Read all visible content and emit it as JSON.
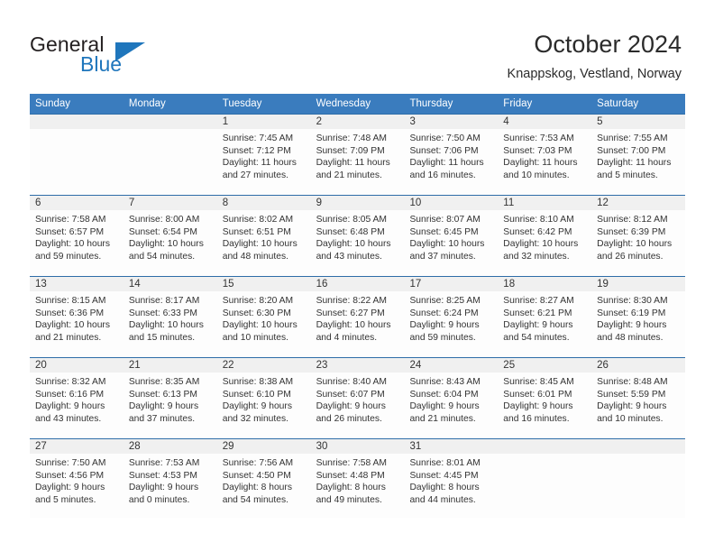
{
  "brand": {
    "name_part1": "General",
    "name_part2": "Blue",
    "logo_icon": "blue-triangle-logo"
  },
  "header": {
    "title": "October 2024",
    "location": "Knappskog, Vestland, Norway"
  },
  "colors": {
    "header_blue": "#3a7cbe",
    "row_divider_blue": "#2e6da8",
    "date_band_gray": "#f0f0f0",
    "brand_blue": "#1f76bc",
    "text": "#333333"
  },
  "calendar": {
    "weekday_headers": [
      "Sunday",
      "Monday",
      "Tuesday",
      "Wednesday",
      "Thursday",
      "Friday",
      "Saturday"
    ],
    "weeks": [
      [
        {
          "day": "",
          "lines": []
        },
        {
          "day": "",
          "lines": []
        },
        {
          "day": "1",
          "lines": [
            "Sunrise: 7:45 AM",
            "Sunset: 7:12 PM",
            "Daylight: 11 hours and 27 minutes."
          ]
        },
        {
          "day": "2",
          "lines": [
            "Sunrise: 7:48 AM",
            "Sunset: 7:09 PM",
            "Daylight: 11 hours and 21 minutes."
          ]
        },
        {
          "day": "3",
          "lines": [
            "Sunrise: 7:50 AM",
            "Sunset: 7:06 PM",
            "Daylight: 11 hours and 16 minutes."
          ]
        },
        {
          "day": "4",
          "lines": [
            "Sunrise: 7:53 AM",
            "Sunset: 7:03 PM",
            "Daylight: 11 hours and 10 minutes."
          ]
        },
        {
          "day": "5",
          "lines": [
            "Sunrise: 7:55 AM",
            "Sunset: 7:00 PM",
            "Daylight: 11 hours and 5 minutes."
          ]
        }
      ],
      [
        {
          "day": "6",
          "lines": [
            "Sunrise: 7:58 AM",
            "Sunset: 6:57 PM",
            "Daylight: 10 hours and 59 minutes."
          ]
        },
        {
          "day": "7",
          "lines": [
            "Sunrise: 8:00 AM",
            "Sunset: 6:54 PM",
            "Daylight: 10 hours and 54 minutes."
          ]
        },
        {
          "day": "8",
          "lines": [
            "Sunrise: 8:02 AM",
            "Sunset: 6:51 PM",
            "Daylight: 10 hours and 48 minutes."
          ]
        },
        {
          "day": "9",
          "lines": [
            "Sunrise: 8:05 AM",
            "Sunset: 6:48 PM",
            "Daylight: 10 hours and 43 minutes."
          ]
        },
        {
          "day": "10",
          "lines": [
            "Sunrise: 8:07 AM",
            "Sunset: 6:45 PM",
            "Daylight: 10 hours and 37 minutes."
          ]
        },
        {
          "day": "11",
          "lines": [
            "Sunrise: 8:10 AM",
            "Sunset: 6:42 PM",
            "Daylight: 10 hours and 32 minutes."
          ]
        },
        {
          "day": "12",
          "lines": [
            "Sunrise: 8:12 AM",
            "Sunset: 6:39 PM",
            "Daylight: 10 hours and 26 minutes."
          ]
        }
      ],
      [
        {
          "day": "13",
          "lines": [
            "Sunrise: 8:15 AM",
            "Sunset: 6:36 PM",
            "Daylight: 10 hours and 21 minutes."
          ]
        },
        {
          "day": "14",
          "lines": [
            "Sunrise: 8:17 AM",
            "Sunset: 6:33 PM",
            "Daylight: 10 hours and 15 minutes."
          ]
        },
        {
          "day": "15",
          "lines": [
            "Sunrise: 8:20 AM",
            "Sunset: 6:30 PM",
            "Daylight: 10 hours and 10 minutes."
          ]
        },
        {
          "day": "16",
          "lines": [
            "Sunrise: 8:22 AM",
            "Sunset: 6:27 PM",
            "Daylight: 10 hours and 4 minutes."
          ]
        },
        {
          "day": "17",
          "lines": [
            "Sunrise: 8:25 AM",
            "Sunset: 6:24 PM",
            "Daylight: 9 hours and 59 minutes."
          ]
        },
        {
          "day": "18",
          "lines": [
            "Sunrise: 8:27 AM",
            "Sunset: 6:21 PM",
            "Daylight: 9 hours and 54 minutes."
          ]
        },
        {
          "day": "19",
          "lines": [
            "Sunrise: 8:30 AM",
            "Sunset: 6:19 PM",
            "Daylight: 9 hours and 48 minutes."
          ]
        }
      ],
      [
        {
          "day": "20",
          "lines": [
            "Sunrise: 8:32 AM",
            "Sunset: 6:16 PM",
            "Daylight: 9 hours and 43 minutes."
          ]
        },
        {
          "day": "21",
          "lines": [
            "Sunrise: 8:35 AM",
            "Sunset: 6:13 PM",
            "Daylight: 9 hours and 37 minutes."
          ]
        },
        {
          "day": "22",
          "lines": [
            "Sunrise: 8:38 AM",
            "Sunset: 6:10 PM",
            "Daylight: 9 hours and 32 minutes."
          ]
        },
        {
          "day": "23",
          "lines": [
            "Sunrise: 8:40 AM",
            "Sunset: 6:07 PM",
            "Daylight: 9 hours and 26 minutes."
          ]
        },
        {
          "day": "24",
          "lines": [
            "Sunrise: 8:43 AM",
            "Sunset: 6:04 PM",
            "Daylight: 9 hours and 21 minutes."
          ]
        },
        {
          "day": "25",
          "lines": [
            "Sunrise: 8:45 AM",
            "Sunset: 6:01 PM",
            "Daylight: 9 hours and 16 minutes."
          ]
        },
        {
          "day": "26",
          "lines": [
            "Sunrise: 8:48 AM",
            "Sunset: 5:59 PM",
            "Daylight: 9 hours and 10 minutes."
          ]
        }
      ],
      [
        {
          "day": "27",
          "lines": [
            "Sunrise: 7:50 AM",
            "Sunset: 4:56 PM",
            "Daylight: 9 hours and 5 minutes."
          ]
        },
        {
          "day": "28",
          "lines": [
            "Sunrise: 7:53 AM",
            "Sunset: 4:53 PM",
            "Daylight: 9 hours and 0 minutes."
          ]
        },
        {
          "day": "29",
          "lines": [
            "Sunrise: 7:56 AM",
            "Sunset: 4:50 PM",
            "Daylight: 8 hours and 54 minutes."
          ]
        },
        {
          "day": "30",
          "lines": [
            "Sunrise: 7:58 AM",
            "Sunset: 4:48 PM",
            "Daylight: 8 hours and 49 minutes."
          ]
        },
        {
          "day": "31",
          "lines": [
            "Sunrise: 8:01 AM",
            "Sunset: 4:45 PM",
            "Daylight: 8 hours and 44 minutes."
          ]
        },
        {
          "day": "",
          "lines": []
        },
        {
          "day": "",
          "lines": []
        }
      ]
    ]
  }
}
